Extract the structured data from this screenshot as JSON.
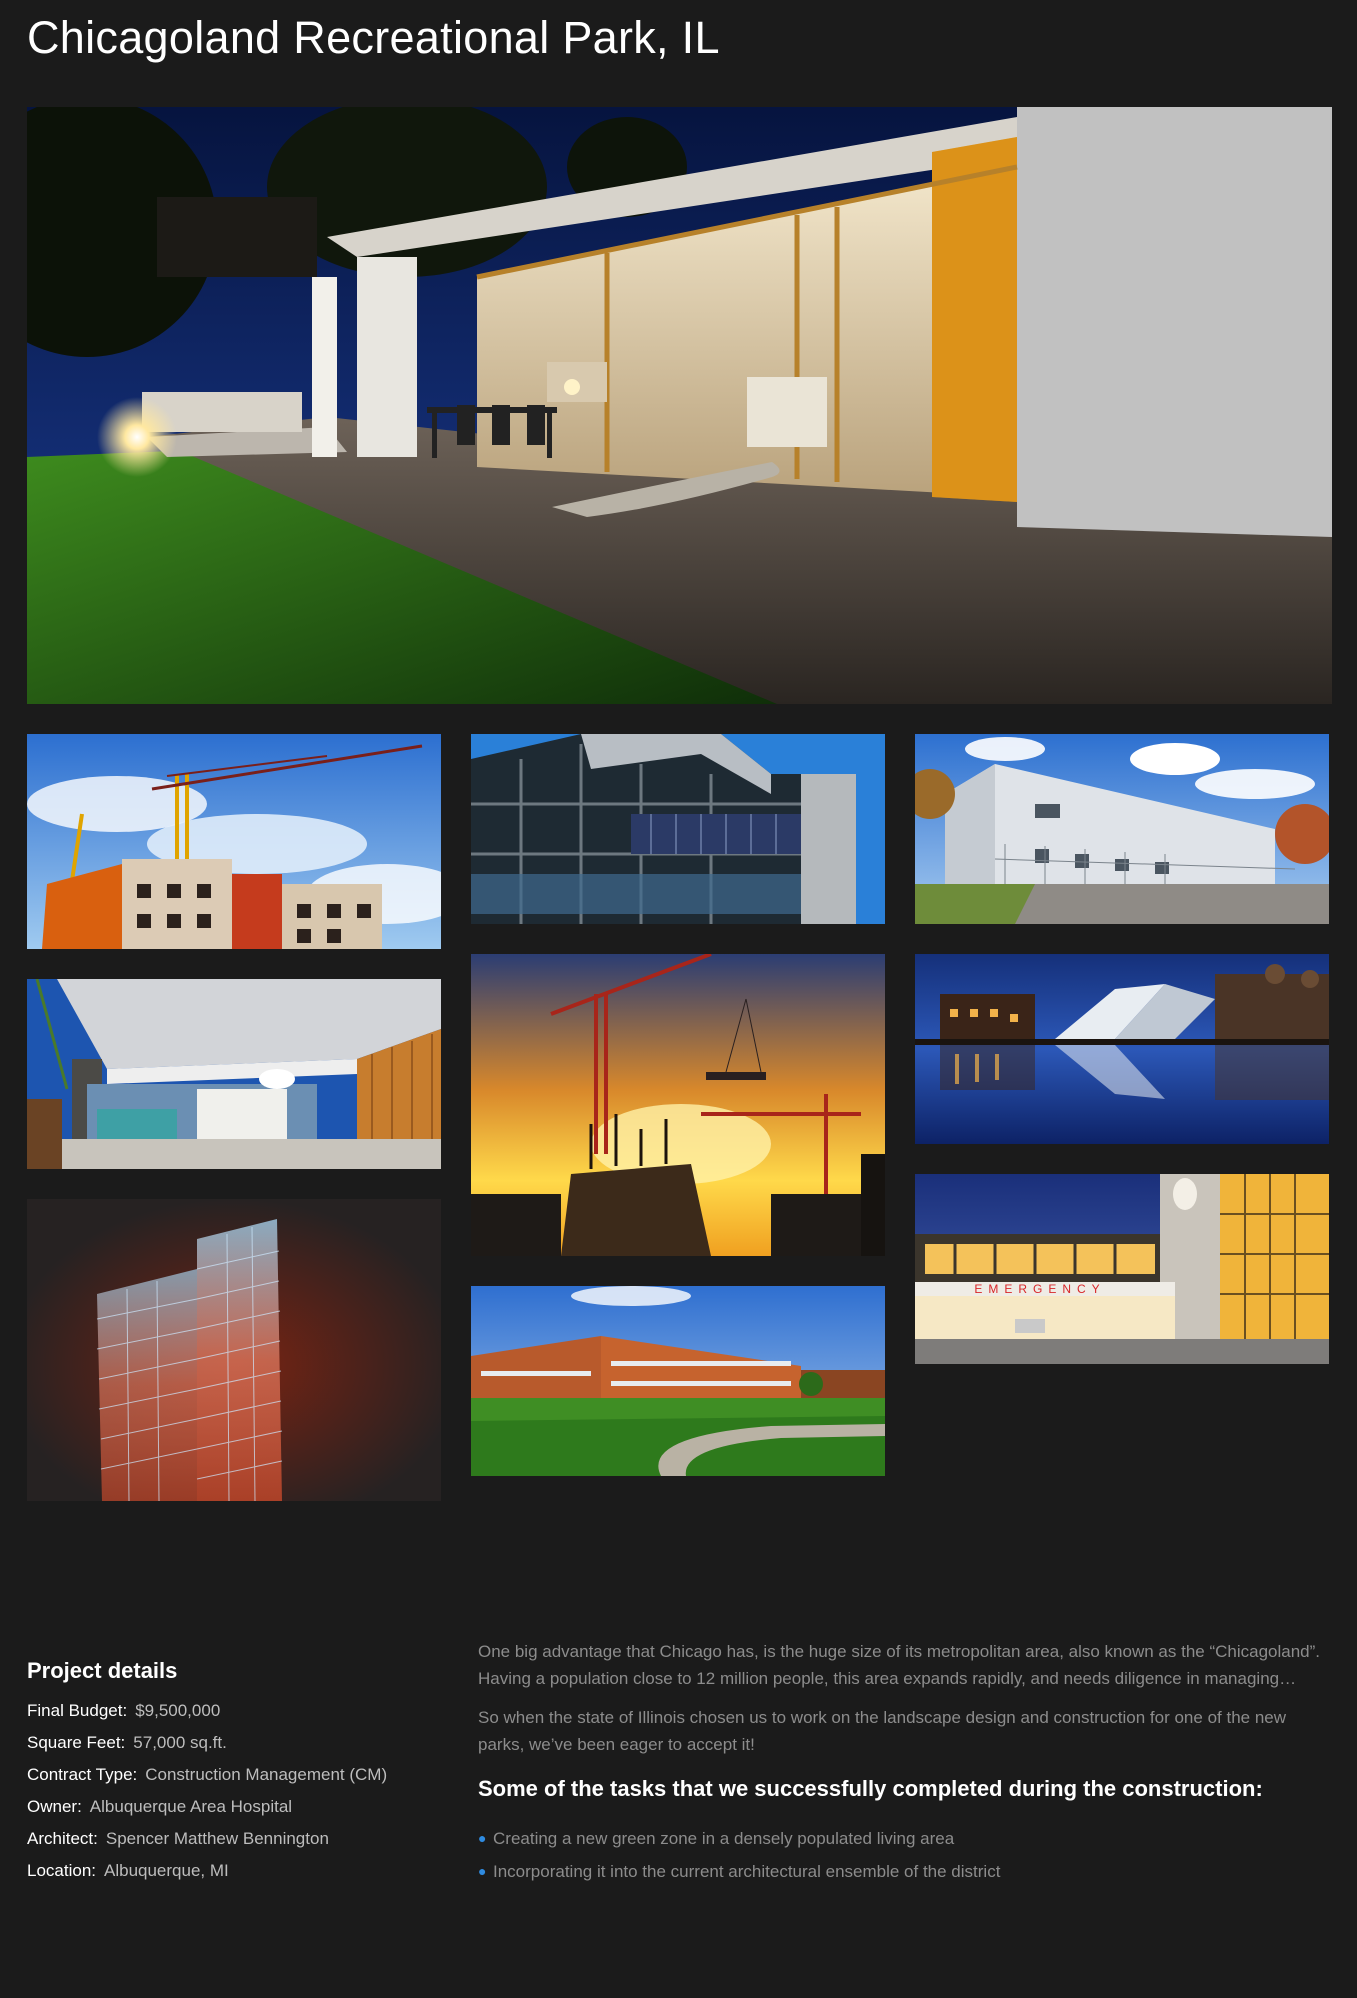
{
  "page": {
    "title": "Chicagoland Recreational Park, IL"
  },
  "gallery": [
    {
      "name": "modern-house-night-photo"
    },
    {
      "name": "tower-crane-photo"
    },
    {
      "name": "glass-office-photo"
    },
    {
      "name": "warehouse-photo"
    },
    {
      "name": "carport-house-photo"
    },
    {
      "name": "sunset-cranes-photo"
    },
    {
      "name": "waterfront-night-photo"
    },
    {
      "name": "wireframe-building-photo"
    },
    {
      "name": "school-campus-photo"
    },
    {
      "name": "hospital-night-photo"
    }
  ],
  "hospital_sign": "EMERGENCY",
  "details": {
    "heading": "Project details",
    "rows": [
      {
        "key": "Final Budget:",
        "value": "$9,500,000"
      },
      {
        "key": "Square Feet:",
        "value": "57,000 sq.ft."
      },
      {
        "key": "Contract Type:",
        "value": "Construction Management (CM)"
      },
      {
        "key": "Owner:",
        "value": "Albuquerque Area Hospital"
      },
      {
        "key": "Architect:",
        "value": "Spencer Matthew Bennington"
      },
      {
        "key": "Location:",
        "value": "Albuquerque, MI"
      }
    ]
  },
  "content": {
    "paragraph1": "One big advantage that Chicago has, is the huge size of its metropolitan area, also known as the “Chicagoland”. Having a population close to 12 million people, this area expands rapidly, and needs diligence in managing…",
    "paragraph2": "So when the state of Illinois chosen us to work on the landscape design and construction for one of the new parks, we’ve been eager to accept it!",
    "heading": "Some of the tasks that we successfully completed during the construction:",
    "bullet_icon": "bullet-icon",
    "bullets": [
      "Creating a new green zone in a densely populated living area",
      "Incorporating it into the current architectural ensemble of the district"
    ]
  },
  "colors": {
    "background": "#1b1b1b",
    "accent": "#2f8be0",
    "muted_text": "#8c8c8c"
  }
}
